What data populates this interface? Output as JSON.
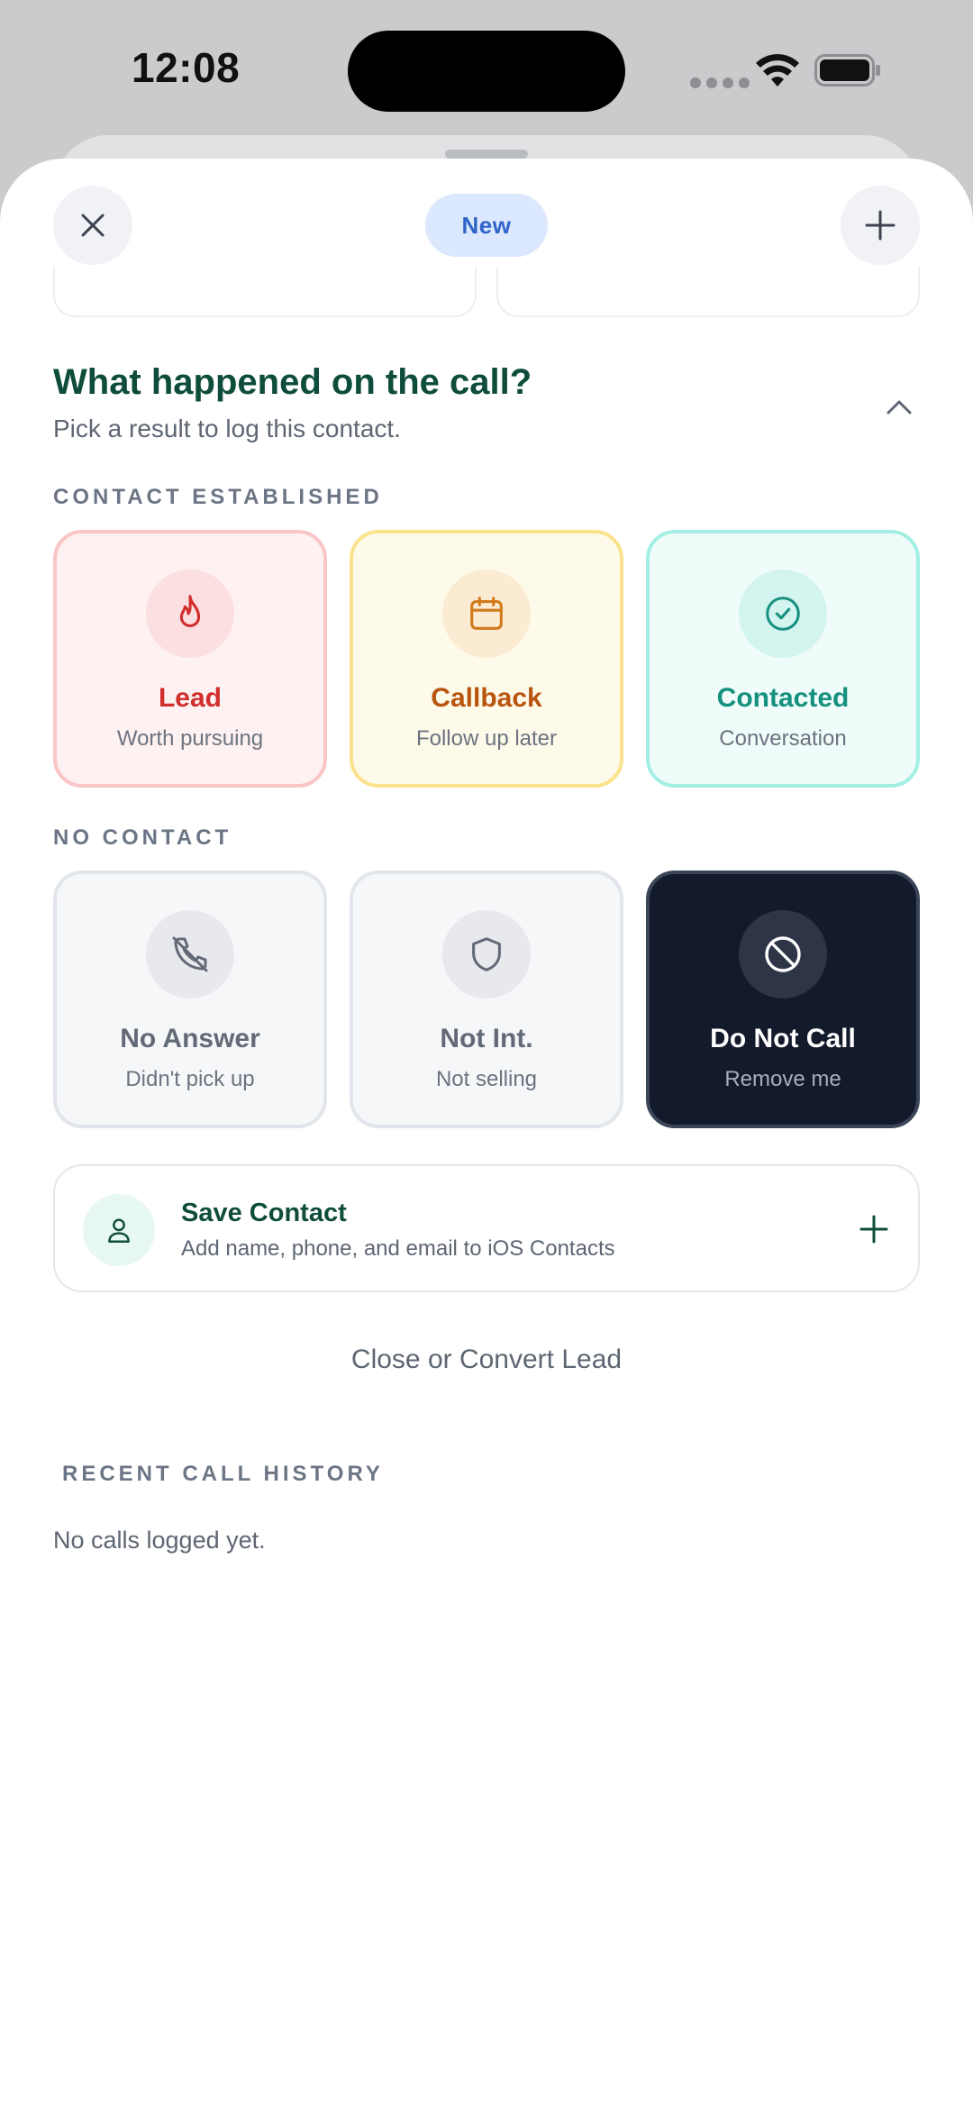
{
  "status_bar": {
    "time": "12:08"
  },
  "header": {
    "status_pill": "New",
    "close_icon": "close-icon",
    "add_icon": "plus-icon"
  },
  "call_result": {
    "title": "What happened on the call?",
    "subtitle": "Pick a result to log this contact.",
    "contact_established_label": "CONTACT ESTABLISHED",
    "no_contact_label": "NO CONTACT",
    "established_options": [
      {
        "title": "Lead",
        "subtitle": "Worth pursuing",
        "icon": "flame-icon",
        "color": "#d22d2d"
      },
      {
        "title": "Callback",
        "subtitle": "Follow up later",
        "icon": "calendar-icon",
        "color": "#b8560f"
      },
      {
        "title": "Contacted",
        "subtitle": "Conversation",
        "icon": "check-circle-icon",
        "color": "#16907f"
      }
    ],
    "no_contact_options": [
      {
        "title": "No Answer",
        "subtitle": "Didn't pick up",
        "icon": "phone-missed-icon"
      },
      {
        "title": "Not Int.",
        "subtitle": "Not selling",
        "icon": "shield-icon"
      },
      {
        "title": "Do Not Call",
        "subtitle": "Remove me",
        "icon": "ban-icon",
        "selected": true
      }
    ]
  },
  "save_contact": {
    "title": "Save Contact",
    "subtitle": "Add name, phone, and email to iOS Contacts"
  },
  "convert_link": "Close or Convert Lead",
  "history": {
    "label": "RECENT CALL HISTORY",
    "empty_text": "No calls logged yet."
  }
}
